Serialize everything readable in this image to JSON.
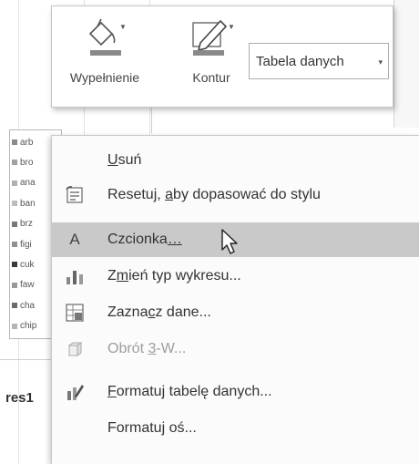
{
  "toolbar": {
    "fill_label": "Wypełnienie",
    "outline_label": "Kontur",
    "element_dropdown": {
      "selected": "Tabela danych",
      "caret": "▾"
    }
  },
  "legend": {
    "rows": [
      {
        "label": "arb",
        "color": "#8a8a8a"
      },
      {
        "label": "bro",
        "color": "#a0a0a0"
      },
      {
        "label": "ana",
        "color": "#b0b0b0"
      },
      {
        "label": "ban",
        "color": "#bdbdbd"
      },
      {
        "label": "brz",
        "color": "#7a7a7a"
      },
      {
        "label": "figi",
        "color": "#909090"
      },
      {
        "label": "cuk",
        "color": "#3a3a3a"
      },
      {
        "label": "faw",
        "color": "#9a9a9a"
      },
      {
        "label": "cha",
        "color": "#6a6a6a"
      },
      {
        "label": "chip",
        "color": "#b5b5b5"
      }
    ]
  },
  "sheet_label": "res1",
  "context_menu": {
    "items": [
      {
        "pre": "",
        "key": "U",
        "post": "suń",
        "icon": "none",
        "disabled": false,
        "highlight": false
      },
      {
        "pre": "Resetuj, ",
        "key": "a",
        "post": "by dopasować do stylu",
        "icon": "reset-style-icon",
        "disabled": false,
        "highlight": false
      },
      {
        "pre": "Czcionka",
        "key": "…",
        "post": "",
        "icon": "font-icon",
        "disabled": false,
        "highlight": true
      },
      {
        "pre": "Z",
        "key": "m",
        "post": "ień typ wykresu...",
        "icon": "chart-type-icon",
        "disabled": false,
        "highlight": false
      },
      {
        "pre": "Zazna",
        "key": "c",
        "post": "z dane...",
        "icon": "select-data-icon",
        "disabled": false,
        "highlight": false
      },
      {
        "pre": "Obrót ",
        "key": "3",
        "post": "-W...",
        "icon": "rotation-3d-icon",
        "disabled": true,
        "highlight": false
      },
      {
        "pre": "",
        "key": "F",
        "post": "ormatuj tabelę danych...",
        "icon": "format-data-table-icon",
        "disabled": false,
        "highlight": false
      },
      {
        "pre": "Formatu",
        "key": "j",
        "post": " oś...",
        "icon": "none",
        "disabled": false,
        "highlight": false
      }
    ]
  },
  "font_icon_glyph": "A"
}
